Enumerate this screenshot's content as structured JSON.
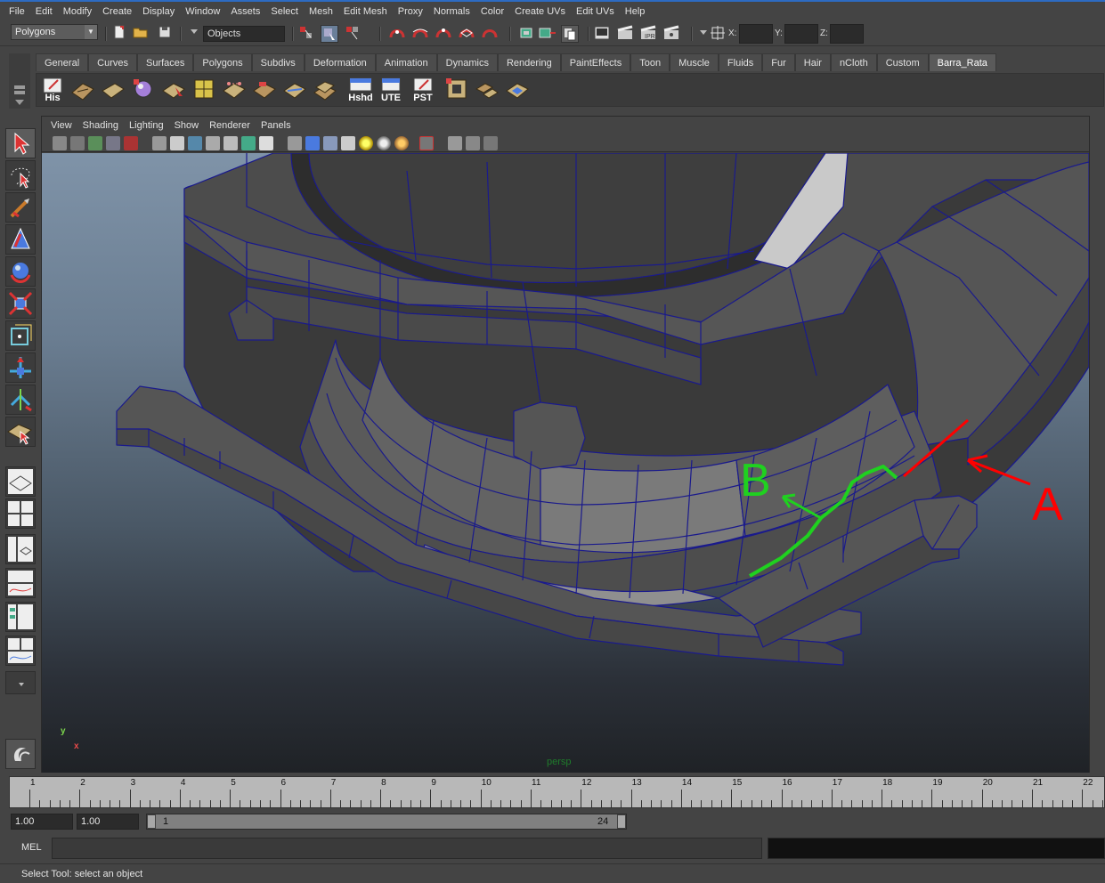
{
  "menubar": {
    "items": [
      "File",
      "Edit",
      "Modify",
      "Create",
      "Display",
      "Window",
      "Assets",
      "Select",
      "Mesh",
      "Edit Mesh",
      "Proxy",
      "Normals",
      "Color",
      "Create UVs",
      "Edit UVs",
      "Help"
    ]
  },
  "status_line": {
    "mode": "Polygons",
    "selection_field": "Objects",
    "x_label": "X:",
    "y_label": "Y:",
    "z_label": "Z:"
  },
  "shelf": {
    "tabs": [
      "General",
      "Curves",
      "Surfaces",
      "Polygons",
      "Subdivs",
      "Deformation",
      "Animation",
      "Dynamics",
      "Rendering",
      "PaintEffects",
      "Toon",
      "Muscle",
      "Fluids",
      "Fur",
      "Hair",
      "nCloth",
      "Custom",
      "Barra_Rata"
    ],
    "active_tab": "Barra_Rata",
    "icon_labels": {
      "his": "His",
      "hshd": "Hshd",
      "ute": "UTE",
      "pst": "PST"
    }
  },
  "viewport": {
    "menu": [
      "View",
      "Shading",
      "Lighting",
      "Show",
      "Renderer",
      "Panels"
    ],
    "camera_label": "persp",
    "axis_y": "y",
    "axis_x": "x",
    "annotations": {
      "label_a": "A",
      "label_b": "B",
      "color_a": "#ff0000",
      "color_b": "#1fd11f"
    }
  },
  "timeline": {
    "ticks": [
      "1",
      "2",
      "3",
      "4",
      "5",
      "6",
      "7",
      "8",
      "9",
      "10",
      "11",
      "12",
      "13",
      "14",
      "15",
      "16",
      "17",
      "18",
      "19",
      "20",
      "21",
      "22"
    ]
  },
  "range": {
    "start_time": "1.00",
    "playback_start": "1.00",
    "range_start": "1",
    "range_end": "24"
  },
  "command_line": {
    "label": "MEL"
  },
  "help_line": {
    "text": "Select Tool: select an object"
  },
  "colors": {
    "wire": "#1a1a8c",
    "mesh_face": "#4a4a4a",
    "accent_blue": "#2d6bc2"
  }
}
